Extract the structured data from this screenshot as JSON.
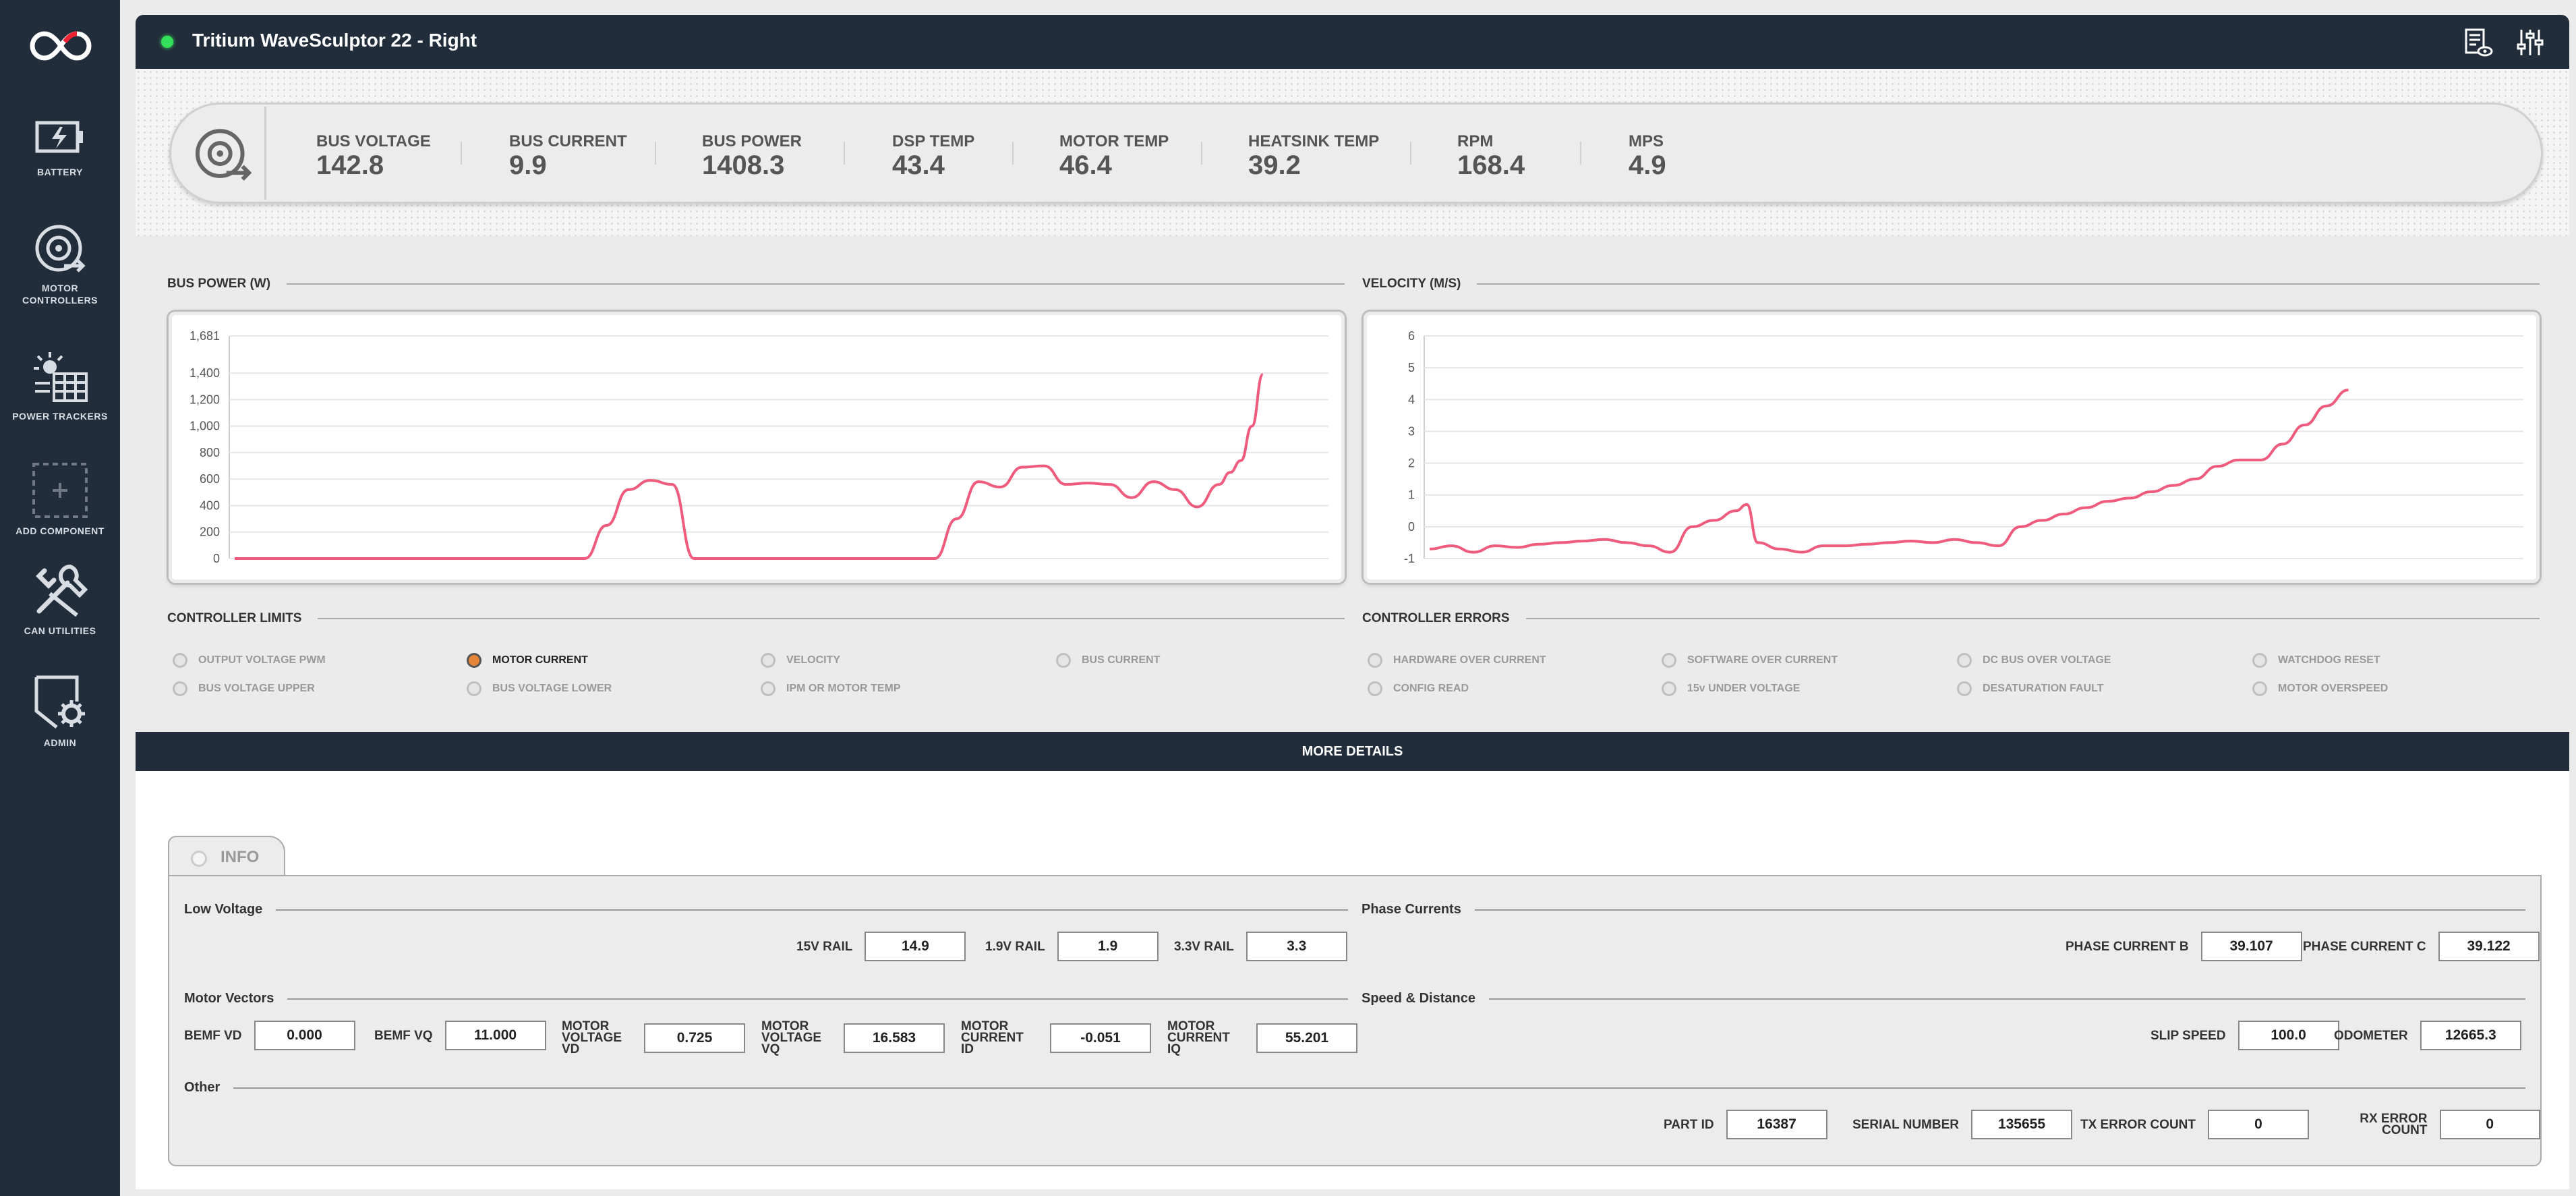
{
  "sidebar": {
    "items": [
      {
        "label": "BATTERY",
        "icon": "battery-charging-icon"
      },
      {
        "label": "MOTOR\nCONTROLLERS",
        "icon": "motor-controller-icon"
      },
      {
        "label": "POWER TRACKERS",
        "icon": "solar-panel-icon"
      },
      {
        "label": "ADD COMPONENT",
        "icon": "add-component-icon"
      },
      {
        "label": "CAN UTILITIES",
        "icon": "tools-icon"
      },
      {
        "label": "ADMIN",
        "icon": "admin-gear-icon"
      }
    ]
  },
  "header": {
    "title": "Tritium WaveSculptor 22 - Right",
    "status_color": "#35e05a"
  },
  "metrics": [
    {
      "label": "BUS VOLTAGE",
      "value": "142.8"
    },
    {
      "label": "BUS CURRENT",
      "value": "9.9"
    },
    {
      "label": "BUS POWER",
      "value": "1408.3"
    },
    {
      "label": "DSP TEMP",
      "value": "43.4"
    },
    {
      "label": "MOTOR TEMP",
      "value": "46.4"
    },
    {
      "label": "HEATSINK TEMP",
      "value": "39.2"
    },
    {
      "label": "RPM",
      "value": "168.4"
    },
    {
      "label": "MPS",
      "value": "4.9"
    }
  ],
  "chart_titles": {
    "power": "BUS POWER (W)",
    "velocity": "VELOCITY (M/S)"
  },
  "chart_data": [
    {
      "type": "line",
      "title": "BUS POWER (W)",
      "color": "#ef5b7d",
      "yticks": [
        "1,681",
        "1,400",
        "1,200",
        "1,000",
        "800",
        "600",
        "400",
        "200",
        "0"
      ],
      "ylim": [
        0,
        1681
      ],
      "x": [
        0,
        4,
        8,
        12,
        16,
        20,
        24,
        28,
        32,
        34,
        36,
        38,
        40,
        42,
        44,
        46,
        48,
        50,
        52,
        54,
        56,
        58,
        60,
        62,
        64,
        66,
        68,
        70,
        72,
        74,
        76,
        78,
        80,
        82,
        84,
        86,
        88,
        90,
        91,
        92,
        93,
        94
      ],
      "values": [
        0,
        0,
        0,
        0,
        0,
        0,
        0,
        0,
        0,
        250,
        520,
        590,
        560,
        0,
        0,
        0,
        0,
        0,
        0,
        0,
        0,
        0,
        0,
        0,
        0,
        300,
        580,
        540,
        690,
        700,
        560,
        570,
        560,
        460,
        580,
        520,
        390,
        560,
        650,
        740,
        1000,
        1390
      ]
    },
    {
      "type": "line",
      "title": "VELOCITY (M/S)",
      "color": "#ef5b7d",
      "yticks": [
        "6",
        "5",
        "4",
        "3",
        "2",
        "1",
        "0",
        "-1"
      ],
      "ylim": [
        -1,
        6
      ],
      "x": [
        0,
        2,
        4,
        6,
        8,
        10,
        12,
        14,
        16,
        18,
        20,
        22,
        24,
        26,
        28,
        29,
        30,
        32,
        34,
        36,
        38,
        40,
        42,
        44,
        46,
        48,
        50,
        52,
        54,
        56,
        58,
        60,
        62,
        64,
        66,
        68,
        70,
        72,
        74,
        76,
        78,
        80,
        82,
        84,
        86,
        88,
        90,
        92,
        94
      ],
      "values": [
        -0.7,
        -0.6,
        -0.8,
        -0.6,
        -0.65,
        -0.55,
        -0.5,
        -0.45,
        -0.4,
        -0.5,
        -0.6,
        -0.8,
        0,
        0.2,
        0.5,
        0.7,
        -0.5,
        -0.7,
        -0.8,
        -0.6,
        -0.6,
        -0.55,
        -0.5,
        -0.45,
        -0.5,
        -0.4,
        -0.5,
        -0.6,
        0.0,
        0.2,
        0.4,
        0.6,
        0.8,
        0.9,
        1.1,
        1.3,
        1.5,
        1.9,
        2.1,
        2.1,
        2.6,
        3.2,
        3.8,
        4.3,
        null,
        null,
        null,
        null,
        null
      ]
    }
  ],
  "limits_title": "CONTROLLER LIMITS",
  "limits": [
    {
      "label": "OUTPUT VOLTAGE PWM",
      "active": false
    },
    {
      "label": "MOTOR CURRENT",
      "active": true
    },
    {
      "label": "VELOCITY",
      "active": false
    },
    {
      "label": "BUS CURRENT",
      "active": false
    },
    {
      "label": "BUS VOLTAGE UPPER",
      "active": false
    },
    {
      "label": "BUS VOLTAGE LOWER",
      "active": false
    },
    {
      "label": "IPM OR MOTOR TEMP",
      "active": false
    }
  ],
  "errors_title": "CONTROLLER ERRORS",
  "errors": [
    {
      "label": "HARDWARE OVER CURRENT",
      "active": false
    },
    {
      "label": "SOFTWARE OVER CURRENT",
      "active": false
    },
    {
      "label": "DC BUS OVER VOLTAGE",
      "active": false
    },
    {
      "label": "WATCHDOG RESET",
      "active": false
    },
    {
      "label": "CONFIG READ",
      "active": false
    },
    {
      "label": "15v UNDER VOLTAGE",
      "active": false
    },
    {
      "label": "DESATURATION FAULT",
      "active": false
    },
    {
      "label": "MOTOR OVERSPEED",
      "active": false
    }
  ],
  "more_details": "MORE DETAILS",
  "info_tab": "INFO",
  "groups": {
    "low_voltage": "Low Voltage",
    "phase_currents": "Phase Currents",
    "motor_vectors": "Motor Vectors",
    "speed_distance": "Speed & Distance",
    "other": "Other"
  },
  "fields": {
    "rail_15v": {
      "label": "15V RAIL",
      "value": "14.9"
    },
    "rail_1_9v": {
      "label": "1.9V RAIL",
      "value": "1.9"
    },
    "rail_3_3v": {
      "label": "3.3V RAIL",
      "value": "3.3"
    },
    "phase_b": {
      "label": "PHASE CURRENT B",
      "value": "39.107"
    },
    "phase_c": {
      "label": "PHASE CURRENT C",
      "value": "39.122"
    },
    "bemf_vd": {
      "label": "BEMF VD",
      "value": "0.000"
    },
    "bemf_vq": {
      "label": "BEMF VQ",
      "value": "11.000"
    },
    "motor_voltage_vd": {
      "label": "MOTOR VOLTAGE VD",
      "value": "0.725"
    },
    "motor_voltage_vq": {
      "label": "MOTOR VOLTAGE VQ",
      "value": "16.583"
    },
    "motor_current_id": {
      "label": "MOTOR CURRENT ID",
      "value": "-0.051"
    },
    "motor_current_iq": {
      "label": "MOTOR CURRENT IQ",
      "value": "55.201"
    },
    "slip_speed": {
      "label": "SLIP SPEED",
      "value": "100.0"
    },
    "odometer": {
      "label": "ODOMETER",
      "value": "12665.3"
    },
    "part_id": {
      "label": "PART ID",
      "value": "16387"
    },
    "serial_number": {
      "label": "SERIAL NUMBER",
      "value": "135655"
    },
    "tx_error_count": {
      "label": "TX ERROR COUNT",
      "value": "0"
    },
    "rx_error_count": {
      "label": "RX ERROR COUNT",
      "value": "0"
    }
  }
}
